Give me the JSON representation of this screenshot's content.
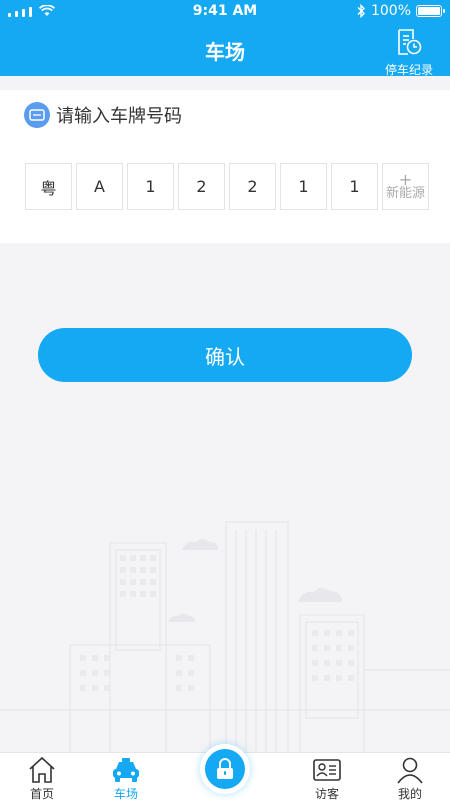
{
  "status_bar": {
    "time": "9:41 AM",
    "battery": "100%"
  },
  "header": {
    "title": "车场",
    "records_label": "停车纪录"
  },
  "plate_input": {
    "prompt": "请输入车牌号码",
    "cells": [
      "粤",
      "A",
      "1",
      "2",
      "2",
      "1",
      "1"
    ],
    "new_energy_plus": "+",
    "new_energy_label": "新能源"
  },
  "confirm_label": "确认",
  "tabbar": {
    "tabs": [
      {
        "label": "首页",
        "icon": "home-icon"
      },
      {
        "label": "车场",
        "icon": "car-icon",
        "active": true
      },
      {
        "label": "访客",
        "icon": "visitor-card-icon"
      },
      {
        "label": "我的",
        "icon": "profile-icon"
      }
    ],
    "center_icon": "lock-icon"
  },
  "colors": {
    "accent": "#14a9f2",
    "background": "#f4f4f6"
  }
}
